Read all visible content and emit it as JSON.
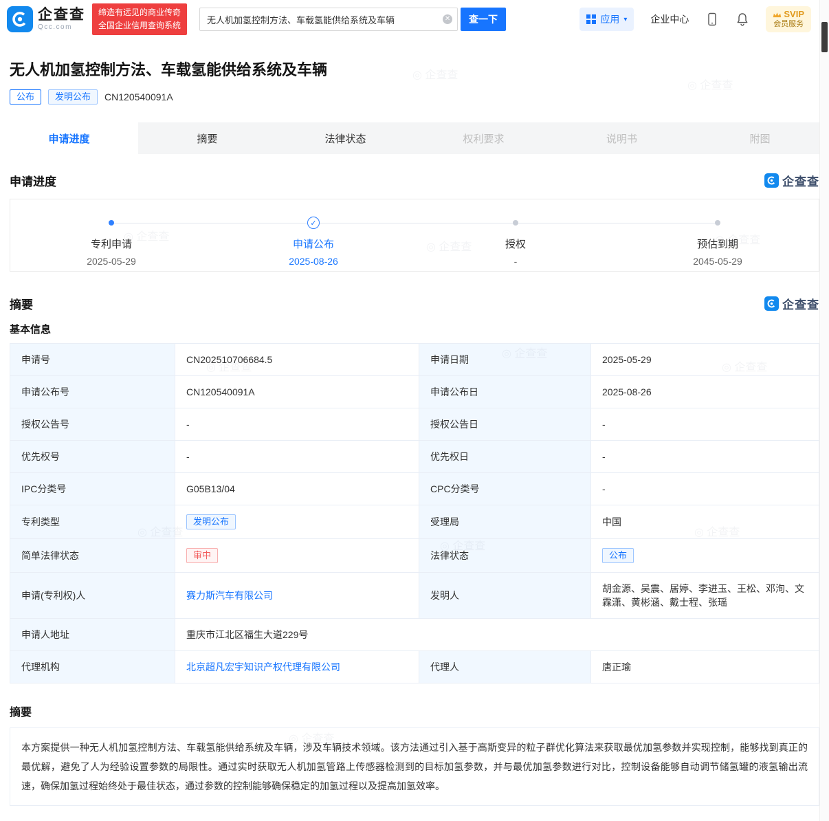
{
  "meta": {
    "brand": "企查查",
    "brand_sub": "Qcc.com",
    "watermark": "◎ 企查查"
  },
  "header": {
    "slogan1": "缔造有远见的商业传奇",
    "slogan2": "全国企业信用查询系统",
    "search_value": "无人机加氢控制方法、车载氢能供给系统及车辆",
    "search_button": "查一下",
    "clear": "✕",
    "apps_label": "应用",
    "caret": "▾",
    "enterprise_center": "企业中心",
    "svip_title": "SVIP",
    "svip_sub": "会员服务"
  },
  "patent": {
    "title": "无人机加氢控制方法、车载氢能供给系统及车辆",
    "tag_publish": "公布",
    "tag_type": "发明公布",
    "number": "CN120540091A"
  },
  "tabs": [
    {
      "label": "申请进度"
    },
    {
      "label": "摘要"
    },
    {
      "label": "法律状态"
    },
    {
      "label": "权利要求"
    },
    {
      "label": "说明书"
    },
    {
      "label": "附图"
    }
  ],
  "progress": {
    "heading": "申请进度",
    "check": "✓",
    "milestones": [
      {
        "label": "专利申请",
        "date": "2025-05-29"
      },
      {
        "label": "申请公布",
        "date": "2025-08-26"
      },
      {
        "label": "授权",
        "date": "-"
      },
      {
        "label": "预估到期",
        "date": "2045-05-29"
      }
    ]
  },
  "summary": {
    "heading": "摘要",
    "basic_heading": "基本信息",
    "rows": [
      {
        "l1": "申请号",
        "v1": "CN202510706684.5",
        "l2": "申请日期",
        "v2": "2025-05-29"
      },
      {
        "l1": "申请公布号",
        "v1": "CN120540091A",
        "l2": "申请公布日",
        "v2": "2025-08-26"
      },
      {
        "l1": "授权公告号",
        "v1": "-",
        "l2": "授权公告日",
        "v2": "-"
      },
      {
        "l1": "优先权号",
        "v1": "-",
        "l2": "优先权日",
        "v2": "-"
      },
      {
        "l1": "IPC分类号",
        "v1": "G05B13/04",
        "l2": "CPC分类号",
        "v2": "-"
      },
      {
        "l1": "专利类型",
        "v1": "发明公布",
        "l2": "受理局",
        "v2": "中国"
      },
      {
        "l1": "简单法律状态",
        "v1": "审中",
        "l2": "法律状态",
        "v2": "公布"
      },
      {
        "l1": "申请(专利权)人",
        "v1": "赛力斯汽车有限公司",
        "l2": "发明人",
        "v2": "胡金源、吴震、居婷、李进玉、王松、邓洵、文霖潇、黄彬涵、戴士程、张瑶"
      },
      {
        "l1": "申请人地址",
        "v1": "重庆市江北区福生大道229号"
      },
      {
        "l1": "代理机构",
        "v1": "北京超凡宏宇知识产权代理有限公司",
        "l2": "代理人",
        "v2": "唐正瑜"
      }
    ],
    "abstract_heading": "摘要",
    "abstract": "本方案提供一种无人机加氢控制方法、车载氢能供给系统及车辆，涉及车辆技术领域。该方法通过引入基于高斯变异的粒子群优化算法来获取最优加氢参数并实现控制，能够找到真正的最优解，避免了人为经验设置参数的局限性。通过实时获取无人机加氢管路上传感器检测到的目标加氢参数，并与最优加氢参数进行对比，控制设备能够自动调节储氢罐的液氢输出流速，确保加氢过程始终处于最佳状态，通过参数的控制能够确保稳定的加氢过程以及提高加氢效率。"
  },
  "colors": {
    "accent": "#1775FF",
    "brand_blue": "#1289EE",
    "slogan_red": "#EE3F3F",
    "label_bg": "#F1F8FF",
    "tag_red": "#F25D5D"
  }
}
